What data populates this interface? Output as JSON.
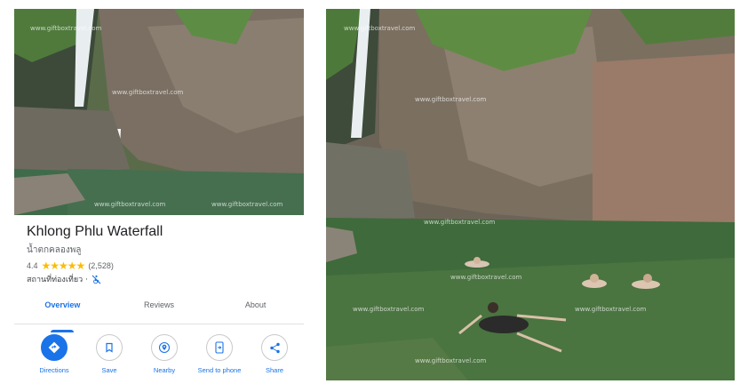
{
  "place": {
    "title": "Khlong Phlu Waterfall",
    "subtitle": "น้ำตกคลองพลู",
    "rating": "4.4",
    "stars": "★★★★★",
    "review_count": "(2,528)",
    "category": "สถานที่ท่องเที่ยว ·"
  },
  "tabs": [
    {
      "label": "Overview",
      "active": true
    },
    {
      "label": "Reviews",
      "active": false
    },
    {
      "label": "About",
      "active": false
    }
  ],
  "actions": [
    {
      "label": "Directions",
      "icon": "directions-icon"
    },
    {
      "label": "Save",
      "icon": "bookmark-icon"
    },
    {
      "label": "Nearby",
      "icon": "nearby-icon"
    },
    {
      "label": "Send to phone",
      "icon": "send-to-phone-icon"
    },
    {
      "label": "Share",
      "icon": "share-icon"
    }
  ],
  "watermark": "www.giftboxtravel.com",
  "colors": {
    "accent": "#1a73e8",
    "star": "#fbbc04",
    "water": "#3f6b4a",
    "rock": "#6e645a"
  }
}
